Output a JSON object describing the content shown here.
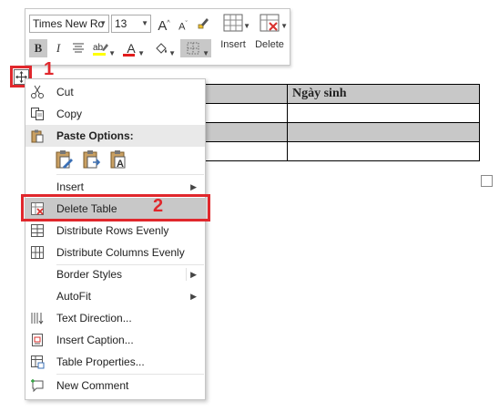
{
  "toolbar": {
    "font_name": "Times New Ro",
    "font_size": "13",
    "grow_font": "A",
    "shrink_font": "A",
    "bold": "B",
    "italic": "I",
    "font_color_letter": "A",
    "insert_label": "Insert",
    "delete_label": "Delete"
  },
  "table": {
    "header": "Ngày sinh"
  },
  "menu": {
    "items": [
      {
        "label": "Cut",
        "icon": "scissors-icon"
      },
      {
        "label": "Copy",
        "icon": "copy-icon"
      },
      {
        "label": "Paste Options:",
        "icon": "clipboard-icon"
      },
      {
        "label": "Insert",
        "icon": "",
        "submenu": true
      },
      {
        "label": "Delete Table",
        "icon": "delete-table-icon",
        "highlighted": true
      },
      {
        "label": "Distribute Rows Evenly",
        "icon": "distribute-rows-icon"
      },
      {
        "label": "Distribute Columns Evenly",
        "icon": "distribute-columns-icon"
      },
      {
        "label": "Border Styles",
        "icon": "",
        "submenu": true
      },
      {
        "label": "AutoFit",
        "icon": "",
        "submenu": true
      },
      {
        "label": "Text Direction...",
        "icon": "text-direction-icon"
      },
      {
        "label": "Insert Caption...",
        "icon": "insert-caption-icon"
      },
      {
        "label": "Table Properties...",
        "icon": "table-properties-icon"
      },
      {
        "label": "New Comment",
        "icon": "new-comment-icon"
      }
    ]
  },
  "annotations": {
    "step1": "1",
    "step2": "2",
    "color": "#e0272c"
  },
  "colors": {
    "highlight": "#c8c8c8",
    "header_shade": "#c8c8c8"
  }
}
